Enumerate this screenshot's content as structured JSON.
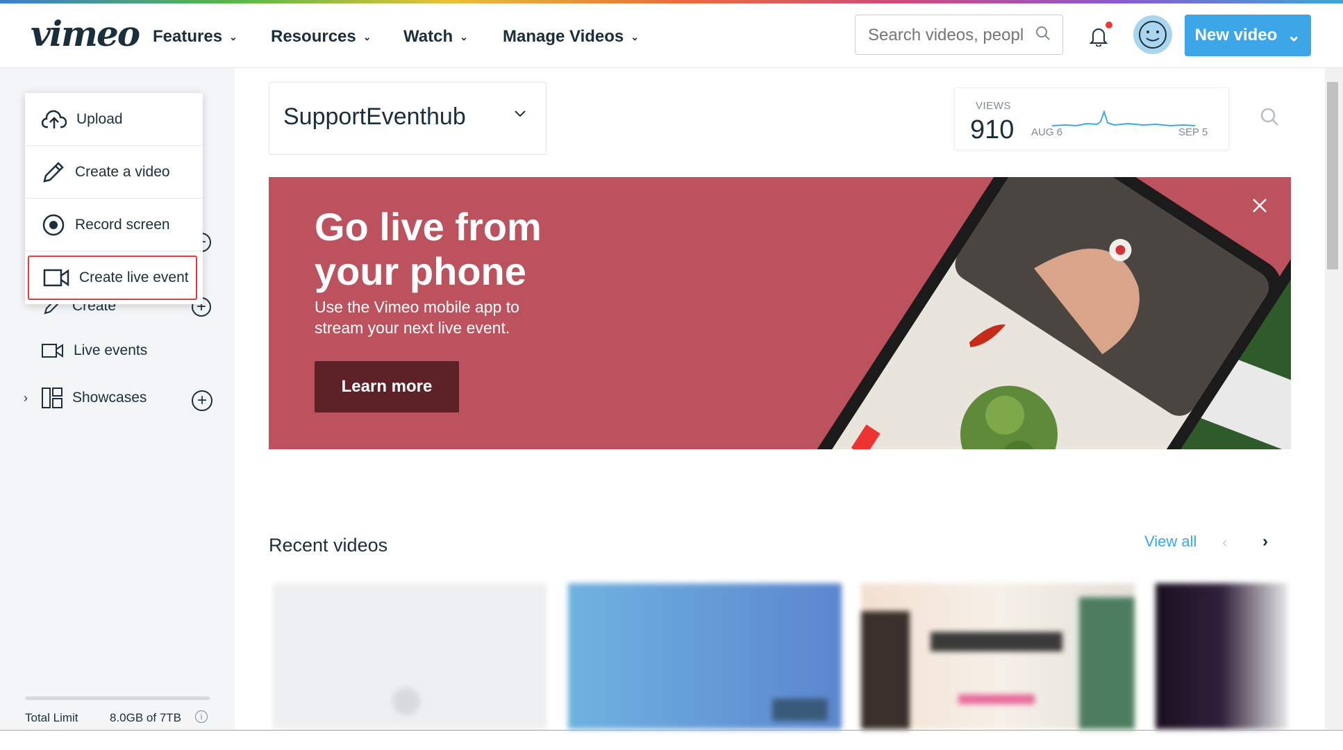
{
  "header": {
    "logo": "vimeo",
    "nav": [
      {
        "label": "Features"
      },
      {
        "label": "Resources"
      },
      {
        "label": "Watch"
      },
      {
        "label": "Manage Videos"
      }
    ],
    "search_placeholder": "Search videos, peopl",
    "new_video_label": "New video",
    "brand_color": "#3ca6e8"
  },
  "dropdown": {
    "items": [
      {
        "label": "Upload",
        "icon": "cloud-upload-icon"
      },
      {
        "label": "Create a video",
        "icon": "pencil-icon"
      },
      {
        "label": "Record screen",
        "icon": "record-icon"
      },
      {
        "label": "Create live event",
        "icon": "video-camera-icon",
        "highlighted": true
      }
    ]
  },
  "sidebar": {
    "items": [
      {
        "label": "Create",
        "icon": "pencil-icon"
      },
      {
        "label": "Live events",
        "icon": "video-camera-icon"
      },
      {
        "label": "Showcases",
        "icon": "showcase-icon"
      }
    ],
    "storage": {
      "label": "Total Limit",
      "value": "8.0GB of 7TB",
      "used_fraction": 0.001
    }
  },
  "channel": {
    "name": "SupportEventhub"
  },
  "stats": {
    "views_label": "VIEWS",
    "views_value": "910",
    "date_start": "AUG 6",
    "date_end": "SEP 5"
  },
  "banner": {
    "title": "Go live from your phone",
    "subtitle": "Use the Vimeo mobile app to stream your next live event.",
    "cta": "Learn more",
    "bg_color": "#bc525e"
  },
  "recent": {
    "title": "Recent videos",
    "view_all": "View all"
  }
}
